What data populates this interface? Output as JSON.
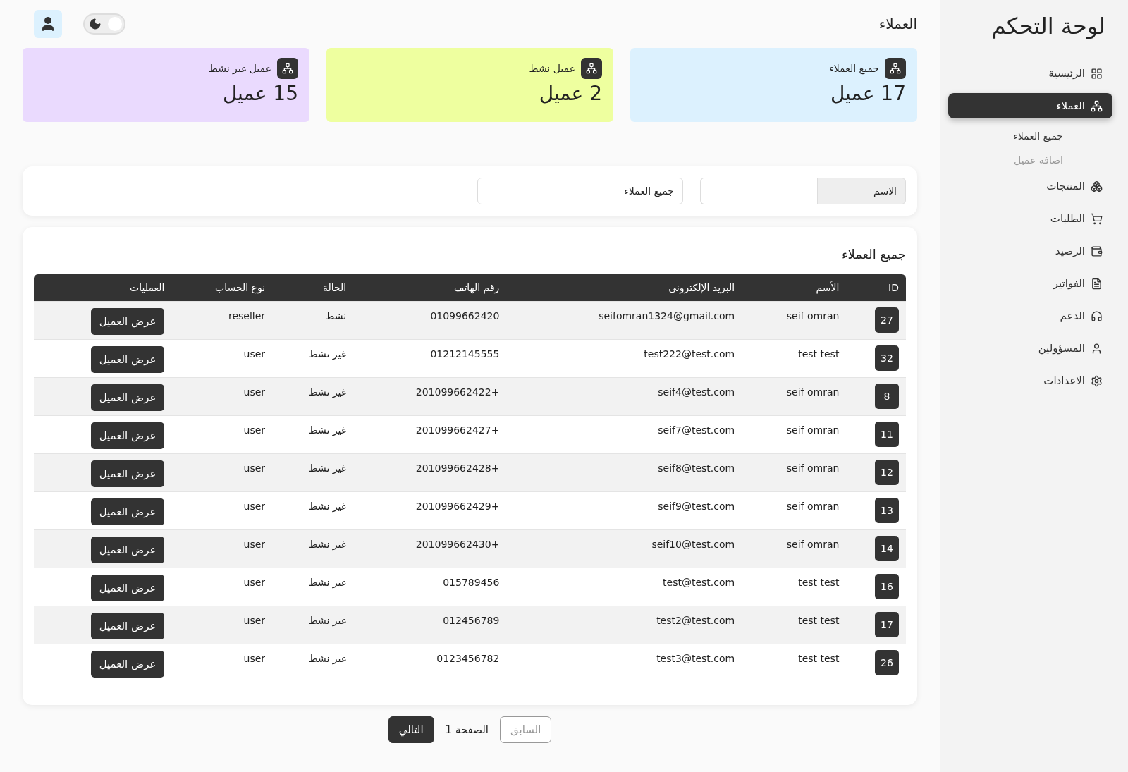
{
  "sidebar": {
    "title": "لوحة التحكم",
    "items": [
      {
        "label": "الرئيسية",
        "selected": false
      },
      {
        "label": "العملاء",
        "selected": true,
        "children": [
          {
            "label": "جميع العملاء",
            "selected": true
          },
          {
            "label": "اضافة عميل",
            "selected": false
          }
        ]
      },
      {
        "label": "المنتجات",
        "selected": false
      },
      {
        "label": "الطلبات",
        "selected": false
      },
      {
        "label": "الرصيد",
        "selected": false
      },
      {
        "label": "الفواتير",
        "selected": false
      },
      {
        "label": "الدعم",
        "selected": false
      },
      {
        "label": "المسؤولين",
        "selected": false
      },
      {
        "label": "الاعدادات",
        "selected": false
      }
    ]
  },
  "header": {
    "title": "العملاء",
    "dark_mode": {
      "on": true
    }
  },
  "stats": [
    {
      "label": "جميع العملاء",
      "value": "17 عميل",
      "color": "#dcf1fe"
    },
    {
      "label": "عميل نشط",
      "value": "2 عميل",
      "color": "#eeff9f"
    },
    {
      "label": "عميل غير نشط",
      "value": "15 عميل",
      "color": "#eadafe"
    }
  ],
  "filters": {
    "name": {
      "label": "الاسم"
    },
    "status": {
      "value": "جميع العملاء"
    }
  },
  "table": {
    "title": "جميع العملاء",
    "columns": [
      "ID",
      "الأسم",
      "البريد الإلكتروني",
      "رقم الهاتف",
      "الحالة",
      "نوع الحساب",
      "العمليات"
    ],
    "rows": [
      {
        "id": "27",
        "name": "seif omran",
        "email": "seifomran1324@gmail.com",
        "phone": "01099662420",
        "status": "نشط",
        "type": "reseller",
        "action": "عرض العميل"
      },
      {
        "id": "32",
        "name": "test test",
        "email": "test222@test.com",
        "phone": "01212145555",
        "status": "غير نشط",
        "type": "user",
        "action": "عرض العميل"
      },
      {
        "id": "8",
        "name": "seif omran",
        "email": "seif4@test.com",
        "phone": "+201099662422",
        "status": "غير نشط",
        "type": "user",
        "action": "عرض العميل"
      },
      {
        "id": "11",
        "name": "seif omran",
        "email": "seif7@test.com",
        "phone": "+201099662427",
        "status": "غير نشط",
        "type": "user",
        "action": "عرض العميل"
      },
      {
        "id": "12",
        "name": "seif omran",
        "email": "seif8@test.com",
        "phone": "+201099662428",
        "status": "غير نشط",
        "type": "user",
        "action": "عرض العميل"
      },
      {
        "id": "13",
        "name": "seif omran",
        "email": "seif9@test.com",
        "phone": "+201099662429",
        "status": "غير نشط",
        "type": "user",
        "action": "عرض العميل"
      },
      {
        "id": "14",
        "name": "seif omran",
        "email": "seif10@test.com",
        "phone": "+201099662430",
        "status": "غير نشط",
        "type": "user",
        "action": "عرض العميل"
      },
      {
        "id": "16",
        "name": "test test",
        "email": "test@test.com",
        "phone": "015789456",
        "status": "غير نشط",
        "type": "user",
        "action": "عرض العميل"
      },
      {
        "id": "17",
        "name": "test test",
        "email": "test2@test.com",
        "phone": "012456789",
        "status": "غير نشط",
        "type": "user",
        "action": "عرض العميل"
      },
      {
        "id": "26",
        "name": "test test",
        "email": "test3@test.com",
        "phone": "0123456782",
        "status": "غير نشط",
        "type": "user",
        "action": "عرض العميل"
      }
    ]
  },
  "pagination": {
    "previous": {
      "label": "السابق",
      "disabled": true
    },
    "page": "الصفحة 1",
    "next": {
      "label": "التالي",
      "disabled": false
    }
  }
}
